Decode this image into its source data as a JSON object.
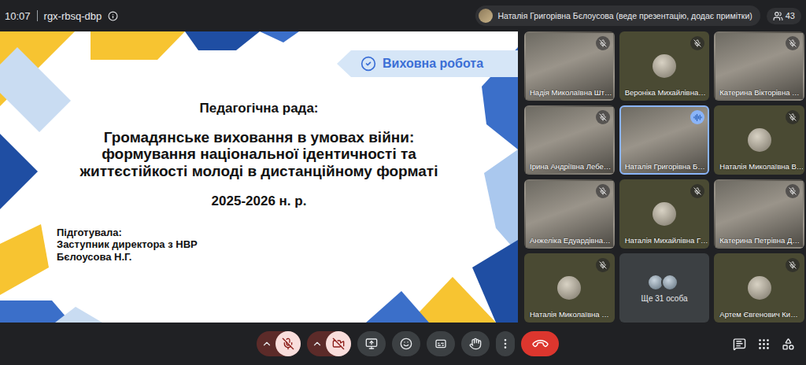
{
  "meeting": {
    "time": "10:07",
    "code": "rgx-rbsq-dbp"
  },
  "presenter": {
    "label": "Наталія Григорівна Бєлоусова (веде презентацію, додає примітки)"
  },
  "participants_count": "43",
  "slide": {
    "banner": "Виховна робота",
    "heading": "Педагогічна рада:",
    "title": "Громадянське виховання в умовах війни: формування національної ідентичності та життєстійкості молоді в дистанційному форматі",
    "year": "2025-2026 н. р.",
    "author_lines": [
      "Підготувала:",
      "Заступник директора з НВР",
      "Бєлоусова Н.Г."
    ]
  },
  "tiles": [
    {
      "name": "Надія Миколаївна Шт…",
      "kind": "video",
      "muted": true,
      "speaking": false
    },
    {
      "name": "Вероніка Михайлівна…",
      "kind": "avatar",
      "muted": true,
      "speaking": false
    },
    {
      "name": "Катерина Вікторівна …",
      "kind": "video",
      "muted": true,
      "speaking": false
    },
    {
      "name": "Ірина Андріївна Лебе…",
      "kind": "video",
      "muted": true,
      "speaking": false
    },
    {
      "name": "Наталія Григорівна Б…",
      "kind": "video",
      "muted": false,
      "speaking": true
    },
    {
      "name": "Наталія Миколаївна В…",
      "kind": "avatar",
      "muted": true,
      "speaking": false
    },
    {
      "name": "Анжеліка Едуардівна…",
      "kind": "video",
      "muted": true,
      "speaking": false
    },
    {
      "name": "Наталія Михайлівна Г…",
      "kind": "avatar",
      "muted": true,
      "speaking": false
    },
    {
      "name": "Катерина Петрівна Д…",
      "kind": "video",
      "muted": true,
      "speaking": false
    },
    {
      "name": "Наталія Миколаївна …",
      "kind": "avatar",
      "muted": true,
      "speaking": false
    },
    {
      "name": "Ще 31 особа",
      "kind": "others",
      "muted": false,
      "speaking": false
    },
    {
      "name": "Артем Євгенович Ки…",
      "kind": "avatar",
      "muted": true,
      "speaking": false
    }
  ],
  "controls": {
    "mic_on": false,
    "camera_on": false
  }
}
